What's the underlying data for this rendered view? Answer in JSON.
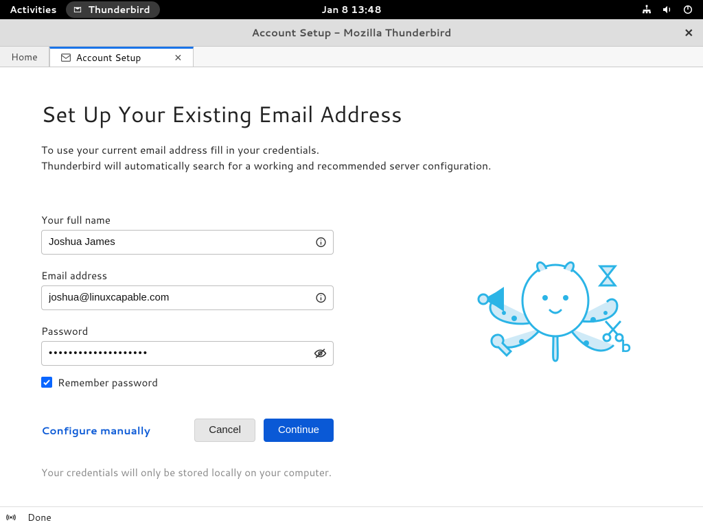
{
  "topbar": {
    "activities": "Activities",
    "app_name": "Thunderbird",
    "clock": "Jan 8  13:48"
  },
  "window": {
    "title": "Account Setup - Mozilla Thunderbird"
  },
  "tabs": {
    "home": "Home",
    "account_setup": "Account Setup"
  },
  "page": {
    "heading": "Set Up Your Existing Email Address",
    "blurb_line1": "To use your current email address fill in your credentials.",
    "blurb_line2": "Thunderbird will automatically search for a working and recommended server configuration."
  },
  "form": {
    "name_label": "Your full name",
    "name_value": "Joshua James",
    "email_label": "Email address",
    "email_value": "joshua@linuxcapable.com",
    "password_label": "Password",
    "password_value": "••••••••••••••••••••",
    "remember_label": "Remember password"
  },
  "actions": {
    "configure_manually": "Configure manually",
    "cancel": "Cancel",
    "continue": "Continue"
  },
  "footnote": "Your credentials will only be stored locally on your computer.",
  "status": {
    "done": "Done"
  }
}
